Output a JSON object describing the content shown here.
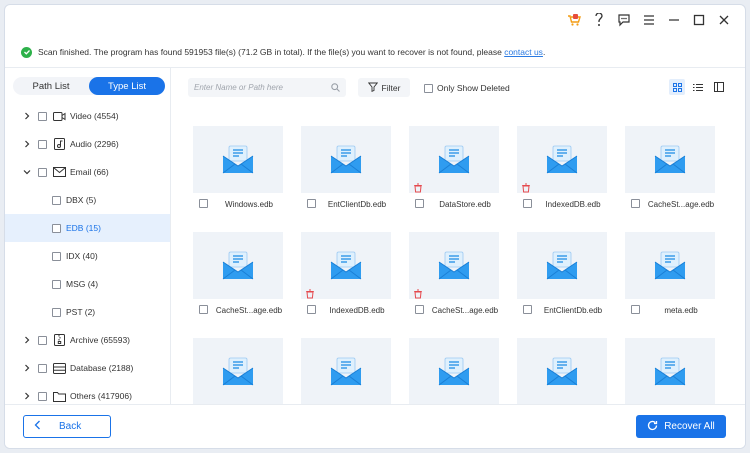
{
  "notice": {
    "text": "Scan finished. The program has found 591953 file(s) (71.2 GB in total). If the file(s) you want to recover is not found, please ",
    "link": "contact us",
    "end": "."
  },
  "tabs": {
    "path_list": "Path List",
    "type_list": "Type List",
    "active": "type_list"
  },
  "tree": {
    "video": "Video (4554)",
    "audio": "Audio (2296)",
    "email": "Email (66)",
    "dbx": "DBX (5)",
    "edb": "EDB (15)",
    "idx": "IDX (40)",
    "msg": "MSG (4)",
    "pst": "PST (2)",
    "archive": "Archive (65593)",
    "database": "Database (2188)",
    "others": "Others (417906)"
  },
  "toolbar": {
    "search_placeholder": "Enter Name or Path here",
    "filter": "Filter",
    "only_deleted": "Only Show Deleted"
  },
  "files": [
    {
      "name": "Windows.edb",
      "deleted": false
    },
    {
      "name": "EntClientDb.edb",
      "deleted": false
    },
    {
      "name": "DataStore.edb",
      "deleted": true
    },
    {
      "name": "IndexedDB.edb",
      "deleted": true
    },
    {
      "name": "CacheSt...age.edb",
      "deleted": false
    },
    {
      "name": "CacheSt...age.edb",
      "deleted": false
    },
    {
      "name": "IndexedDB.edb",
      "deleted": true
    },
    {
      "name": "CacheSt...age.edb",
      "deleted": true
    },
    {
      "name": "EntClientDb.edb",
      "deleted": false
    },
    {
      "name": "meta.edb",
      "deleted": false
    },
    {
      "name": "",
      "deleted": false
    },
    {
      "name": "",
      "deleted": false
    },
    {
      "name": "",
      "deleted": false
    },
    {
      "name": "",
      "deleted": false
    },
    {
      "name": "",
      "deleted": false
    }
  ],
  "footer": {
    "back": "Back",
    "recover_all": "Recover All"
  },
  "colors": {
    "accent": "#1a73e8",
    "success": "#2db14a",
    "deleted": "#e5484d",
    "card_bg": "#eff3f8"
  },
  "icons": [
    "cart-icon",
    "user-icon",
    "feedback-icon",
    "menu-icon",
    "minimize-icon",
    "maximize-icon",
    "close-icon",
    "email-file-icon",
    "trash-icon",
    "search-icon",
    "filter-icon",
    "grid-view-icon",
    "list-view-icon",
    "detail-view-icon",
    "recover-icon",
    "back-arrow-icon"
  ]
}
